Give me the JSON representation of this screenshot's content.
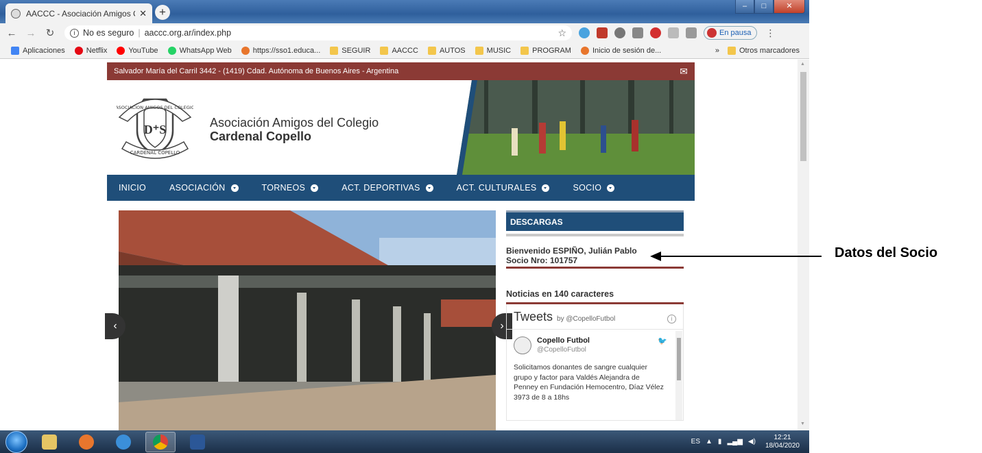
{
  "browser": {
    "tab_title": "AACCC - Asociación Amigos Colé",
    "address_secure_label": "No es seguro",
    "address_url": "aaccc.org.ar/index.php",
    "profile_label": "En pausa"
  },
  "bookmarks": {
    "items": [
      {
        "label": "Aplicaciones",
        "icon": "apps-grid-icon"
      },
      {
        "label": "Netflix",
        "icon": "netflix-icon"
      },
      {
        "label": "YouTube",
        "icon": "youtube-icon"
      },
      {
        "label": "WhatsApp Web",
        "icon": "whatsapp-icon"
      },
      {
        "label": "https://sso1.educa...",
        "icon": "site-icon"
      },
      {
        "label": "SEGUIR",
        "icon": "folder-icon"
      },
      {
        "label": "AACCC",
        "icon": "folder-icon"
      },
      {
        "label": "AUTOS",
        "icon": "folder-icon"
      },
      {
        "label": "MUSIC",
        "icon": "folder-icon"
      },
      {
        "label": "PROGRAM",
        "icon": "folder-icon"
      },
      {
        "label": "Inicio de sesión de...",
        "icon": "site-icon"
      }
    ],
    "overflow": "»",
    "other": "Otros marcadores"
  },
  "site": {
    "address_strip": "Salvador María del Carril 3442 - (1419) Cdad. Autónoma de Buenos Aires - Argentina",
    "logo_text_top": "ASOCIACION AMIGOS DEL COLEGIO",
    "logo_text_bottom": "CARDENAL COPELLO",
    "name_line1": "Asociación Amigos del Colegio",
    "name_line2": "Cardenal Copello",
    "nav": [
      {
        "label": "INICIO",
        "dropdown": false
      },
      {
        "label": "ASOCIACIÓN",
        "dropdown": true
      },
      {
        "label": "TORNEOS",
        "dropdown": true
      },
      {
        "label": "ACT. DEPORTIVAS",
        "dropdown": true
      },
      {
        "label": "ACT. CULTURALES",
        "dropdown": true
      },
      {
        "label": "SOCIO",
        "dropdown": true
      }
    ],
    "sidebar": {
      "descargas": "DESCARGAS",
      "welcome_line1": "Bienvenido ESPIÑO, Julián Pablo",
      "welcome_line2": "Socio Nro: 101757",
      "news_title": "Noticias en 140 caracteres",
      "tweets_title": "Tweets",
      "tweets_by": "by @CopelloFutbol",
      "tweet_name": "Copello Futbol",
      "tweet_handle": "@CopelloFutbol",
      "tweet_text": "Solicitamos donantes de sangre cualquier grupo y factor para Valdés Alejandra de Penney en Fundación Hemocentro, Díaz Vélez 3973 de 8 a 18hs"
    }
  },
  "taskbar": {
    "lang": "ES",
    "time": "12:21",
    "date": "18/04/2020"
  },
  "annotation": {
    "label": "Datos del Socio"
  }
}
